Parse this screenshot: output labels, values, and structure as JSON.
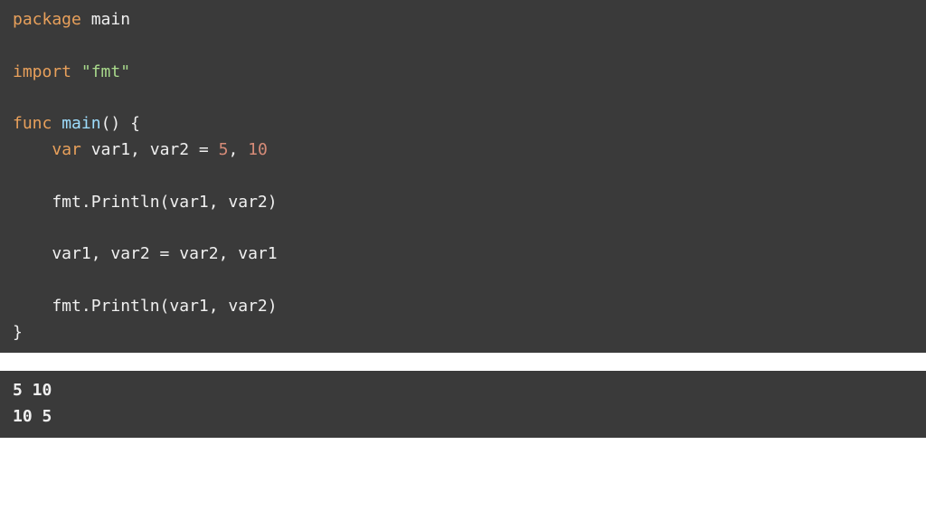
{
  "code": {
    "line1": {
      "kw_package": "package",
      "name": "main"
    },
    "line3": {
      "kw_import": "import",
      "str_fmt": "\"fmt\""
    },
    "line5": {
      "kw_func": "func",
      "func_name": "main",
      "open": "() {"
    },
    "line6": {
      "kw_var": "var",
      "decl": " var1, var2 = ",
      "num1": "5",
      "comma": ", ",
      "num2": "10"
    },
    "line8": {
      "stmt": "    fmt.Println(var1, var2)"
    },
    "line10": {
      "stmt": "    var1, var2 = var2, var1"
    },
    "line12": {
      "stmt": "    fmt.Println(var1, var2)"
    },
    "line13": {
      "close": "}"
    }
  },
  "output": {
    "line1": "5 10",
    "line2": "10 5"
  }
}
